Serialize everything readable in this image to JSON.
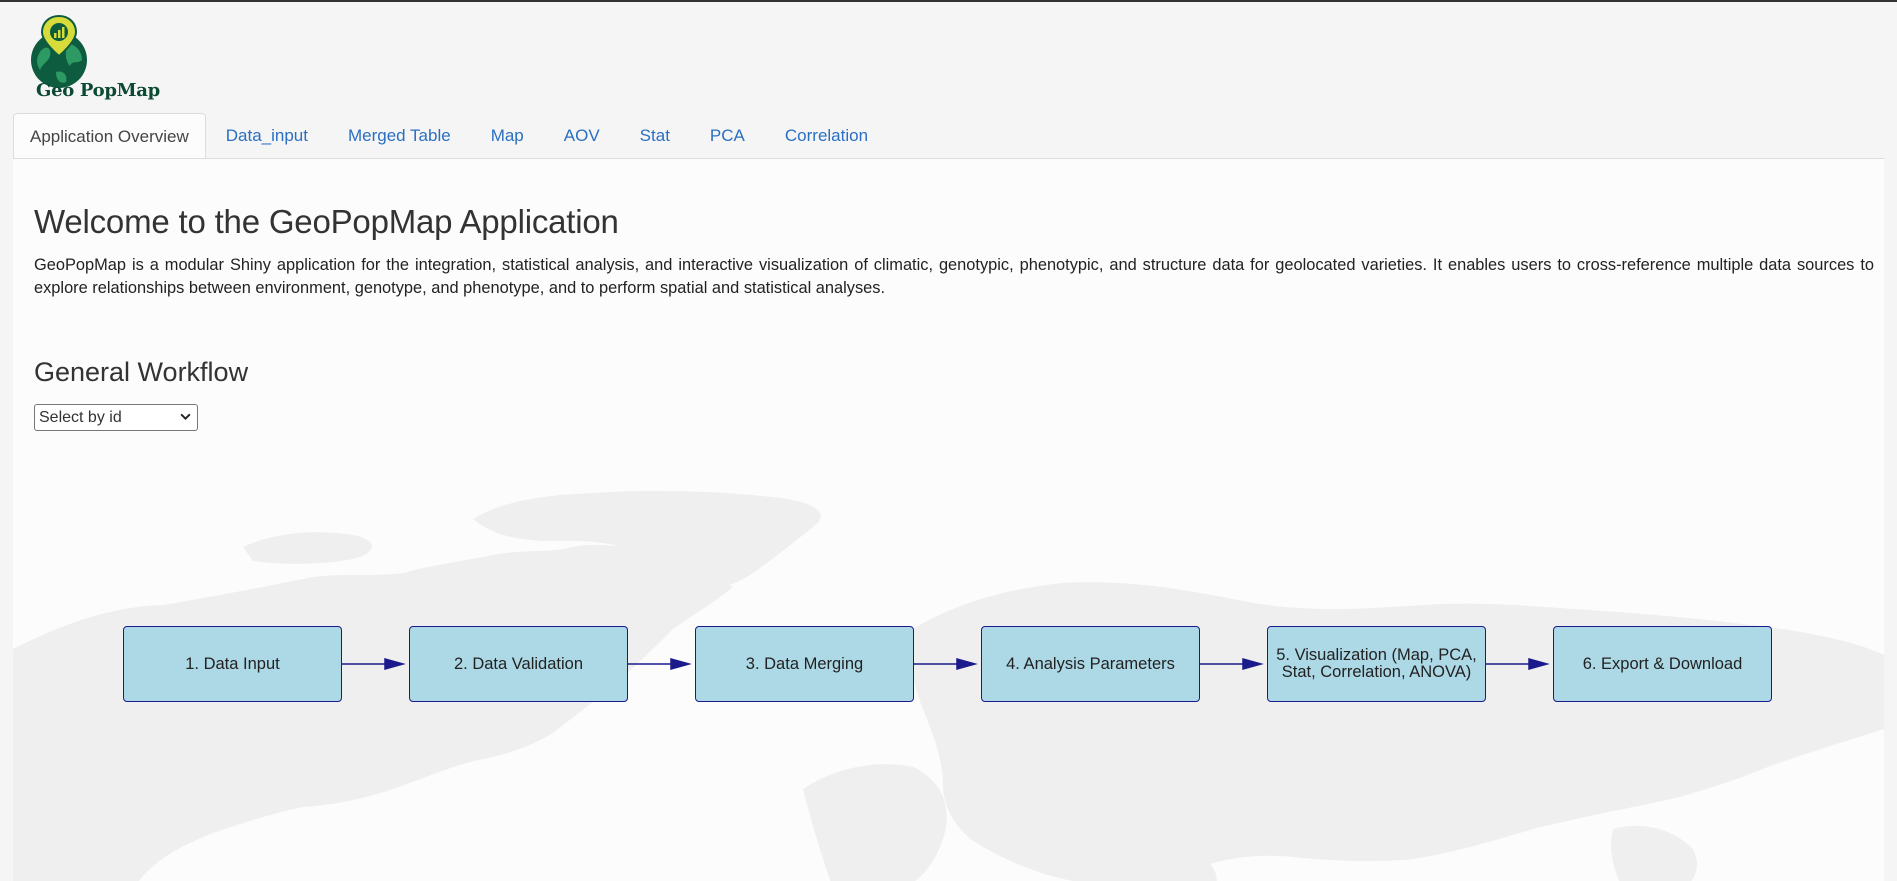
{
  "app": {
    "logo_text": "Geo PopMap"
  },
  "tabs": [
    {
      "label": "Application Overview",
      "active": true
    },
    {
      "label": "Data_input"
    },
    {
      "label": "Merged Table"
    },
    {
      "label": "Map"
    },
    {
      "label": "AOV"
    },
    {
      "label": "Stat"
    },
    {
      "label": "PCA"
    },
    {
      "label": "Correlation"
    }
  ],
  "overview": {
    "title": "Welcome to the GeoPopMap Application",
    "description": "GeoPopMap is a modular Shiny application for the integration, statistical analysis, and interactive visualization of climatic, genotypic, phenotypic, and structure data for geolocated varieties. It enables users to cross-reference multiple data sources to explore relationships between environment, genotype, and phenotype, and to perform spatial and statistical analyses.",
    "workflow_title": "General Workflow",
    "select": {
      "value": "Select by id"
    }
  },
  "workflow": {
    "nodes": [
      {
        "label": "1. Data Input"
      },
      {
        "label": "2. Data Validation"
      },
      {
        "label": "3. Data Merging"
      },
      {
        "label": "4. Analysis Parameters"
      },
      {
        "label": "5. Visualization (Map, PCA, Stat, Correlation, ANOVA)"
      },
      {
        "label": "6. Export & Download"
      }
    ]
  },
  "colors": {
    "tab_link": "#2a6fc2",
    "node_fill": "#add8e6",
    "node_border": "#1a1a8c",
    "logo_green": "#0d5c3f",
    "logo_yellow": "#d7dc3a"
  }
}
